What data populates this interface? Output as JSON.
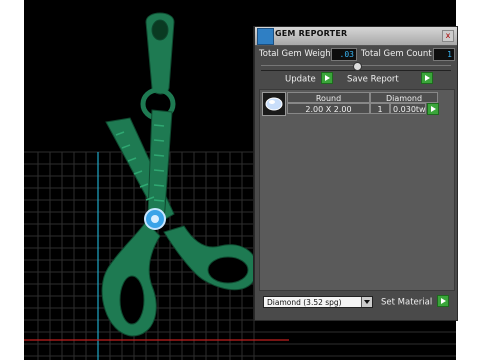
{
  "panel": {
    "title": "GEM REPORTER",
    "close_label": "x",
    "total_weight_label": "Total Gem Weight",
    "total_weight_value": ".03",
    "total_count_label": "Total Gem Count",
    "total_count_value": "1",
    "update_label": "Update",
    "save_report_label": "Save Report"
  },
  "table": {
    "shape": "Round",
    "material": "Diamond",
    "size": "2.00 X 2.00",
    "count": "1",
    "weight": "0.030tw"
  },
  "footer": {
    "material_select": "Diamond    (3.52 spg)",
    "set_material_label": "Set Material"
  }
}
